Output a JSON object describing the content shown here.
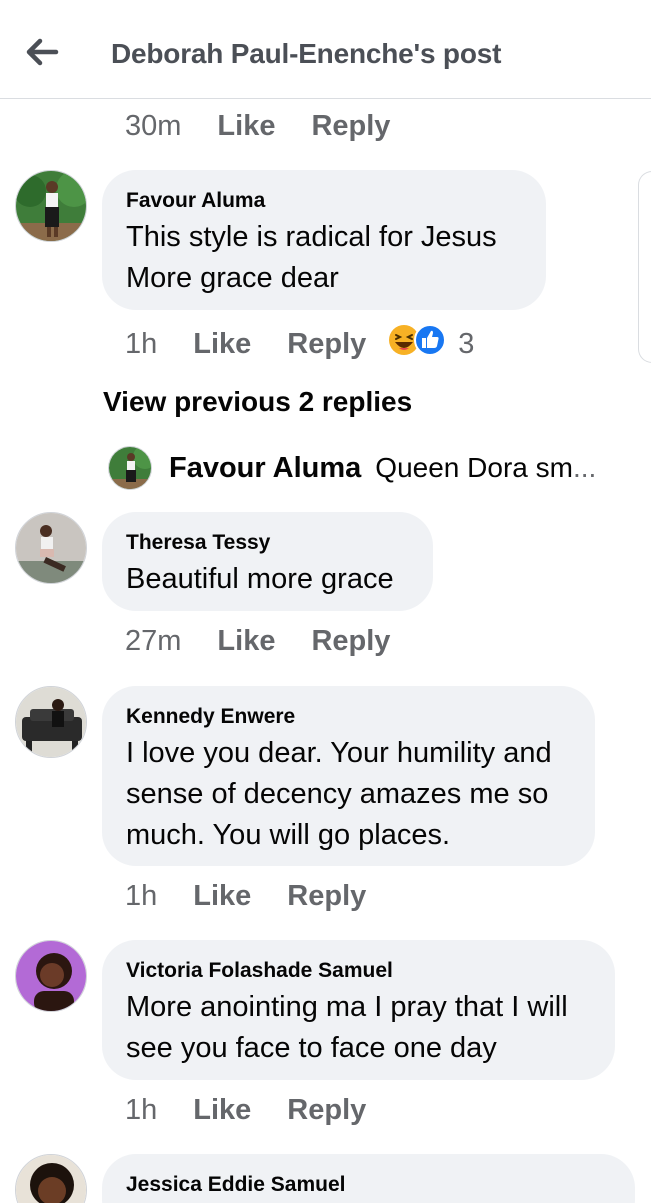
{
  "header": {
    "title": "Deborah Paul-Enenche's post"
  },
  "top_meta": {
    "time": "30m",
    "like": "Like",
    "reply": "Reply"
  },
  "comments": [
    {
      "author": "Favour Aluma",
      "text": "This style is radical for Jesus\nMore grace dear",
      "time": "1h",
      "like": "Like",
      "reply": "Reply",
      "reaction_count": "3",
      "reaction_icons": [
        "laugh-react-icon",
        "like-react-icon"
      ]
    },
    {
      "author": "Theresa Tessy",
      "text": "Beautiful more grace",
      "time": "27m",
      "like": "Like",
      "reply": "Reply"
    },
    {
      "author": "Kennedy Enwere",
      "text": "I love you dear. Your humility and\nsense of decency amazes me so\nmuch. You will go places.",
      "time": "1h",
      "like": "Like",
      "reply": "Reply"
    },
    {
      "author": "Victoria Folashade Samuel",
      "text": "More anointing ma I pray that I will\nsee you face to face one day",
      "time": "1h",
      "like": "Like",
      "reply": "Reply"
    },
    {
      "author": "Jessica Eddie Samuel"
    }
  ],
  "view_previous": "View previous 2 replies",
  "reply_preview": {
    "author": "Favour Aluma",
    "text": "Queen Dora sm",
    "ellipsis": "..."
  },
  "colors": {
    "bubble": "#f0f2f5",
    "meta": "#65676b",
    "haha": "#f7b125",
    "like": "#1877f2"
  }
}
